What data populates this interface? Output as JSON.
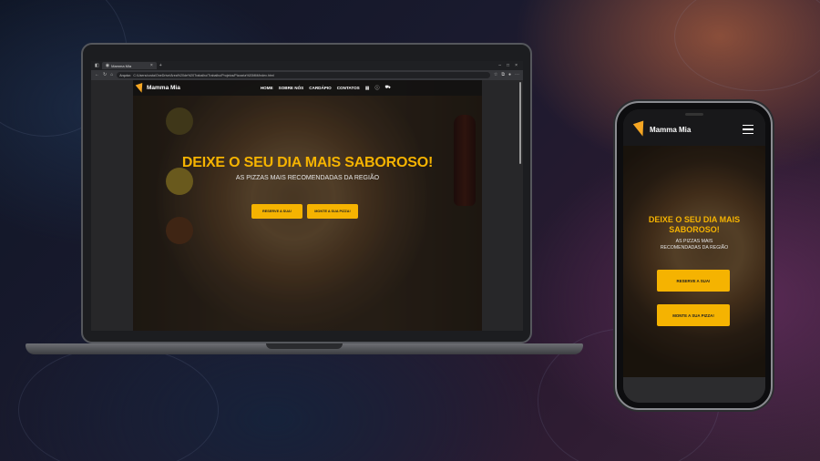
{
  "browser": {
    "tab_title": "Mamma Mia",
    "tab_close": "×",
    "new_tab": "+",
    "address_badge": "Arquivo",
    "address_url": "C:/Users/costa/OneDrive/Área%20de%20Trabalho/Trabalho/Projetos/Pizzaria%20MM/index.html",
    "window_controls": [
      "–",
      "□",
      "×"
    ]
  },
  "site": {
    "brand": "Mamma Mia",
    "menu": [
      "HOME",
      "SOBRE NÓS",
      "CARDÁPIO",
      "CONTATOS"
    ],
    "menu_icons": [
      "calendar-icon",
      "info-icon",
      "cart-icon"
    ],
    "hero_title": "DEIXE O SEU DIA MAIS SABOROSO!",
    "hero_subtitle": "AS PIZZAS MAIS RECOMENDADAS DA REGIÃO",
    "cta_reserve": "RESERVE A SUA!",
    "cta_build": "MONTE A SUA PIZZA!"
  },
  "phone": {
    "brand": "Mamma Mia",
    "hero_title": "DEIXE O SEU DIA MAIS SABOROSO!",
    "hero_subtitle": "AS PIZZAS MAIS RECOMENDADAS DA REGIÃO",
    "cta_reserve": "RESERVE A SUA!",
    "cta_build": "MONTE A SUA PIZZA!"
  },
  "colors": {
    "accent": "#f5b301",
    "nav_bg": "#121212",
    "text": "#ffffff"
  }
}
